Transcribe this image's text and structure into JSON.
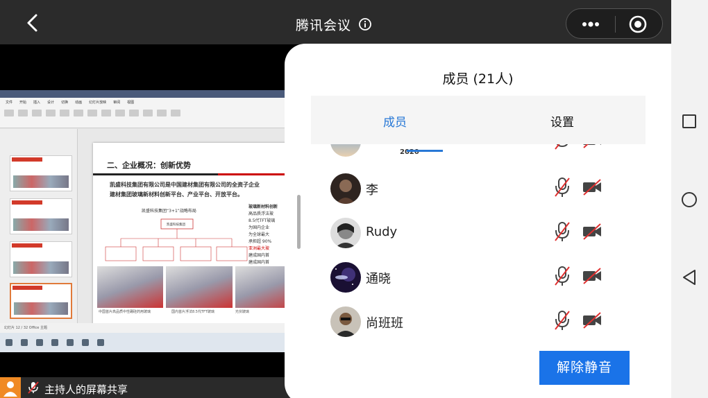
{
  "app": {
    "title": "腾讯会议"
  },
  "topbar": {
    "back_icon": "chevron-left-icon",
    "info_icon": "info-icon",
    "more_icon": "more-dots-icon",
    "record_icon": "record-icon"
  },
  "shared_screen": {
    "slide_heading": "二、企业概况：创新优势",
    "slide_body_1": "凯盛科技集团有限公司是中国建材集团有限公司的全资子企业",
    "slide_body_2": "建材集团玻璃新材料创新平台、产业平台、开放平台。",
    "strategy_title": "凯盛科技集团“3+1”战略布局",
    "org_root": "凯盛科技集团",
    "org_children": [
      "中央应用研究院",
      "显示材料、应用材料平台公司",
      "新能源材料平台公司",
      "凯盛浮法与特种玻璃平台公司"
    ],
    "right_col_title": "玻璃新材料创新",
    "right_col_lines": [
      "高品质浮法玻",
      "8.5代TFT玻璃",
      "为国内企业",
      "为全球最大",
      "承担超 90%",
      "亚洲最大玻",
      "建成国内首",
      "建成国内首"
    ],
    "captions": [
      "中国首片高品质中性硼硅药用玻璃",
      "国内首片浮法8.5代TFT玻璃",
      "光伏玻璃"
    ],
    "status_text": "幻灯片 12 / 32    Office 主题",
    "share_label": "主持人的屏幕共享"
  },
  "panel": {
    "title": "成员 (21人)",
    "tabs": [
      "成员",
      "设置"
    ],
    "members": [
      {
        "name": "李",
        "mic": "mic-muted-icon",
        "cam": "camera-off-icon"
      },
      {
        "name": "Rudy",
        "mic": "mic-muted-icon",
        "cam": "camera-off-icon"
      },
      {
        "name": "通晓",
        "mic": "mic-muted-icon",
        "cam": "camera-off-icon"
      },
      {
        "name": "尚班班",
        "mic": "mic-muted-icon",
        "cam": "camera-off-icon"
      }
    ],
    "partial_top_badge": "2020",
    "unmute_label": "解除静音"
  },
  "colors": {
    "accent": "#2878d6",
    "button": "#1a73e8",
    "muted_red": "#e03030"
  }
}
